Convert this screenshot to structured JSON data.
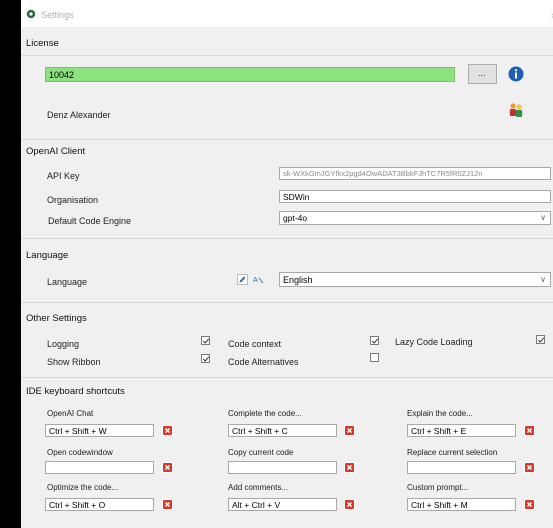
{
  "window": {
    "title": "Settings",
    "close": "✕"
  },
  "license": {
    "header": "License",
    "key": "10042",
    "browse_label": "...",
    "user": "Denz Alexander"
  },
  "openai": {
    "header": "OpenAI Client",
    "api_key_label": "API Key",
    "api_key_value": "sk-WXkGmJGYfkx2pgd4OwADAT3BbkFJhTC7R5fR0ZJ12n",
    "org_label": "Organisation",
    "org_value": "SDWin",
    "engine_label": "Default Code Engine",
    "engine_value": "gpt-4o"
  },
  "language": {
    "header": "Language",
    "label": "Language",
    "value": "English"
  },
  "other": {
    "header": "Other Settings",
    "logging": "Logging",
    "show_ribbon": "Show Ribbon",
    "code_context": "Code context",
    "code_alternatives": "Code Alternatives",
    "lazy_loading": "Lazy Code Loading",
    "logging_checked": true,
    "show_ribbon_checked": true,
    "code_context_checked": true,
    "code_alternatives_checked": false,
    "lazy_loading_checked": true
  },
  "ide": {
    "header": "IDE keyboard shortcuts",
    "shortcuts": [
      {
        "label": "OpenAI Chat",
        "value": "Ctrl + Shift + W"
      },
      {
        "label": "Complete the code...",
        "value": "Ctrl + Shift + C"
      },
      {
        "label": "Explain the code...",
        "value": "Ctrl + Shift + E"
      },
      {
        "label": "Open codewindow",
        "value": ""
      },
      {
        "label": "Copy current code",
        "value": ""
      },
      {
        "label": "Replace current selection",
        "value": ""
      },
      {
        "label": "Optimize the code...",
        "value": "Ctrl + Shift + O"
      },
      {
        "label": "Add comments...",
        "value": "Alt + Ctrl + V"
      },
      {
        "label": "Custom prompt...",
        "value": "Ctrl + Shift + M"
      }
    ]
  },
  "colors": {
    "license_ok": "#8ce27f",
    "info_blue": "#1e5fb4",
    "clear_red": "#d23b2c"
  },
  "icons": [
    "gear-icon",
    "info-icon",
    "users-icon",
    "edit-icon",
    "translate-icon",
    "clear-icon",
    "dropdown-chevron-icon",
    "checkmark-icon"
  ]
}
